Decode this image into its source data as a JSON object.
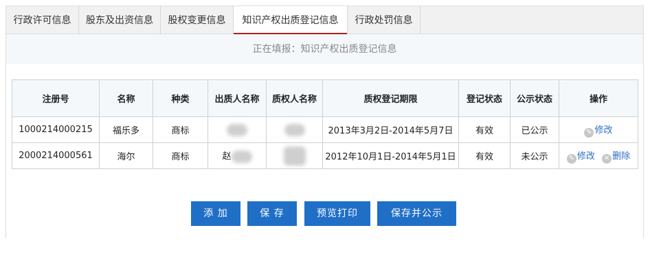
{
  "tabs": [
    {
      "label": "行政许可信息"
    },
    {
      "label": "股东及出资信息"
    },
    {
      "label": "股权变更信息"
    },
    {
      "label": "知识产权出质登记信息"
    },
    {
      "label": "行政处罚信息"
    }
  ],
  "active_tab_index": 3,
  "filling_text": "正在填报：知识产权出质登记信息",
  "table": {
    "headers": [
      "注册号",
      "名称",
      "种类",
      "出质人名称",
      "质权人名称",
      "质权登记期限",
      "登记状态",
      "公示状态",
      "操作"
    ],
    "rows": [
      {
        "reg_no": "1000214000215",
        "name": "福乐多",
        "type": "商标",
        "pledgor": "",
        "pledgee": "",
        "period": "2013年3月2日-2014年5月7日",
        "reg_status": "有效",
        "pub_status": "已公示",
        "ops": [
          "修改"
        ]
      },
      {
        "reg_no": "2000214000561",
        "name": "海尔",
        "type": "商标",
        "pledgor": "赵",
        "pledgee": "",
        "period": "2012年10月1日-2014年5月1日",
        "reg_status": "有效",
        "pub_status": "未公示",
        "ops": [
          "修改",
          "删除"
        ]
      }
    ]
  },
  "buttons": {
    "add": "添 加",
    "save": "保 存",
    "preview": "预览打印",
    "save_publish": "保存并公示"
  },
  "colors": {
    "accent": "#1f6fc7",
    "active_tab_underline": "#b01c1c",
    "link": "#2a6cc8"
  }
}
